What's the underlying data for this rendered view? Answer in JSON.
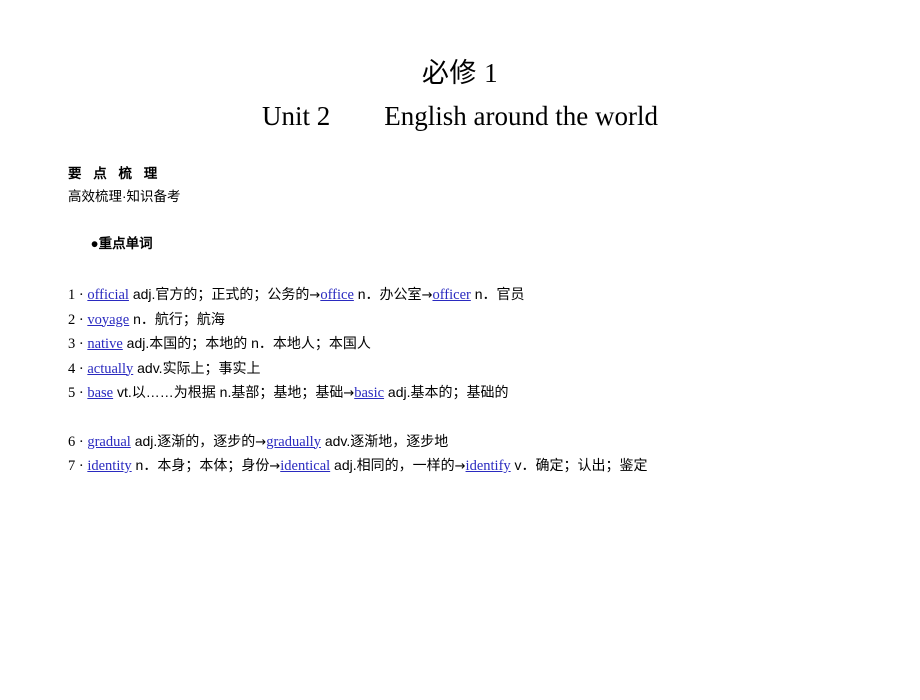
{
  "slide": {
    "title_main": "必修 1",
    "title_sub": "Unit 2　　English around the world",
    "section_heading": "要 点 梳 理",
    "section_subheading": "高效梳理·知识备考",
    "group_bullet": "●",
    "group_heading": "重点单词",
    "link_color": "#2a2ac0",
    "background_color": "#ffffff",
    "text_color": "#000000",
    "arrow_glyph": "→",
    "entries": [
      {
        "number": "1",
        "sep": "·",
        "text": "official adj.官方的；正式的；公务的→office n．办公室→officer n．官员",
        "parts": [
          {
            "type": "word",
            "value": "official"
          },
          {
            "type": "plain",
            "value": " adj.官方的；正式的；公务的"
          },
          {
            "type": "arrow",
            "value": "→"
          },
          {
            "type": "word",
            "value": "office"
          },
          {
            "type": "plain",
            "value": " n．办公室"
          },
          {
            "type": "arrow",
            "value": "→"
          },
          {
            "type": "word",
            "value": "officer"
          },
          {
            "type": "plain",
            "value": " n．官员"
          }
        ]
      },
      {
        "number": "2",
        "sep": "·",
        "text": "voyage n．航行；航海",
        "parts": [
          {
            "type": "word",
            "value": "voyage"
          },
          {
            "type": "plain",
            "value": " n．航行；航海"
          }
        ]
      },
      {
        "number": "3",
        "sep": "·",
        "text": "native adj.本国的；本地的 n．本地人；本国人",
        "parts": [
          {
            "type": "word",
            "value": "native"
          },
          {
            "type": "plain",
            "value": " adj.本国的；本地的 n．本地人；本国人"
          }
        ]
      },
      {
        "number": "4",
        "sep": "·",
        "text": "actually adv.实际上；事实上",
        "parts": [
          {
            "type": "word",
            "value": "actually"
          },
          {
            "type": "plain",
            "value": " adv.实际上；事实上"
          }
        ]
      },
      {
        "number": "5",
        "sep": "·",
        "text": "base vt.以……为根据 n.基部；基地；基础→basic adj.基本的；基础的",
        "parts": [
          {
            "type": "word",
            "value": "base"
          },
          {
            "type": "plain",
            "value": " vt.以……为根据 n.基部；基地；基础"
          },
          {
            "type": "arrow",
            "value": "→"
          },
          {
            "type": "word",
            "value": "basic"
          },
          {
            "type": "plain",
            "value": " adj.基本的；基础的"
          }
        ]
      },
      {
        "number": "6",
        "sep": "·",
        "gap_before": true,
        "text": "gradual adj.逐渐的，逐步的→gradually adv.逐渐地，逐步地",
        "parts": [
          {
            "type": "word",
            "value": "gradual"
          },
          {
            "type": "plain",
            "value": " adj.逐渐的，逐步的"
          },
          {
            "type": "arrow",
            "value": "→"
          },
          {
            "type": "word",
            "value": "gradually"
          },
          {
            "type": "plain",
            "value": " adv.逐渐地，逐步地"
          }
        ]
      },
      {
        "number": "7",
        "sep": "·",
        "text": "identity n．本身；本体；身份→identical adj.相同的，一样的→identify v．确定；认出；鉴定",
        "parts": [
          {
            "type": "word",
            "value": "identity"
          },
          {
            "type": "plain",
            "value": " n．本身；本体；身份"
          },
          {
            "type": "arrow",
            "value": "→"
          },
          {
            "type": "word",
            "value": "identical"
          },
          {
            "type": "plain",
            "value": " adj.相同的，一样的"
          },
          {
            "type": "arrow",
            "value": "→"
          },
          {
            "type": "word",
            "value": "identify"
          },
          {
            "type": "plain",
            "value": " v．确定；认出；鉴定"
          }
        ]
      }
    ]
  }
}
